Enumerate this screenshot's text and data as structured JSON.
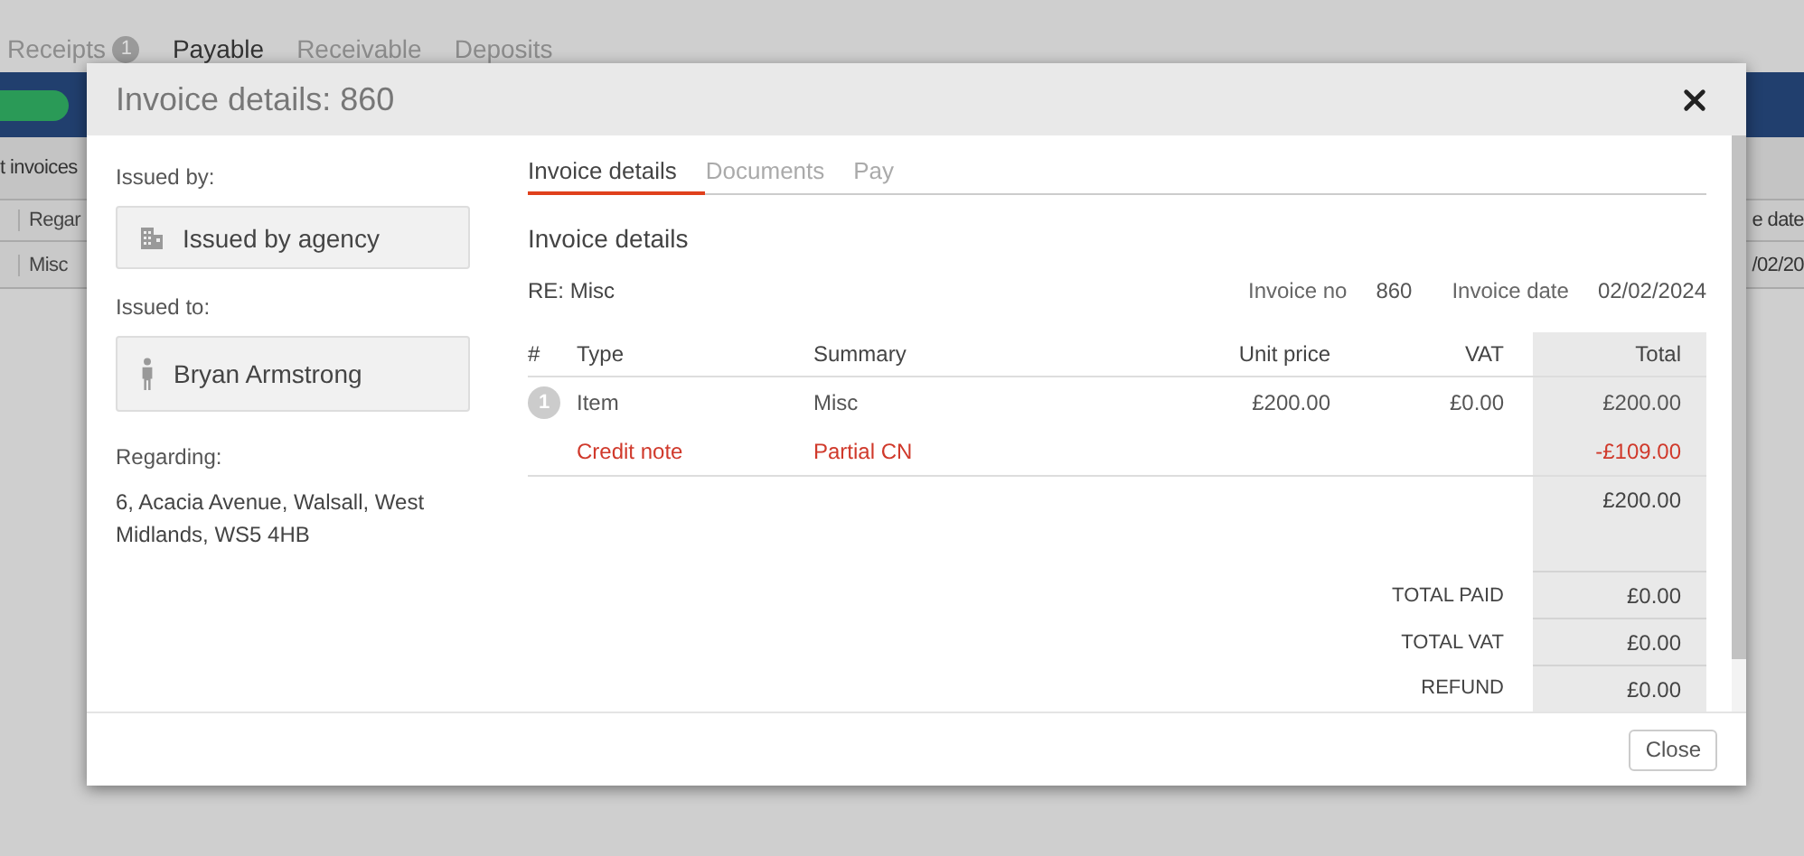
{
  "page": {
    "tabs": [
      {
        "label": "Receipts",
        "badge": "1",
        "selected": false
      },
      {
        "label": "Payable",
        "selected": true
      },
      {
        "label": "Receivable",
        "selected": false
      },
      {
        "label": "Deposits",
        "selected": false
      }
    ],
    "list_caption": "t invoices",
    "table": {
      "columns": [
        "Regar",
        "e date"
      ],
      "rows": [
        [
          "Misc",
          "/02/20"
        ]
      ]
    }
  },
  "dialog": {
    "title": "Invoice details: 860",
    "issued_by": {
      "label": "Issued by:",
      "value": "Issued by agency"
    },
    "issued_to": {
      "label": "Issued to:",
      "value": "Bryan Armstrong"
    },
    "regarding": {
      "label": "Regarding:",
      "value": "6, Acacia Avenue, Walsall, West Midlands, WS5 4HB"
    },
    "tabs": [
      {
        "label": "Invoice details",
        "selected": true
      },
      {
        "label": "Documents",
        "selected": false
      },
      {
        "label": "Pay",
        "selected": false
      }
    ],
    "heading": "Invoice details",
    "re": "RE: Misc",
    "meta": [
      {
        "label": "Invoice no",
        "value": "860"
      },
      {
        "label": "Invoice date",
        "value": "02/02/2024"
      }
    ],
    "columns": [
      "#",
      "Type",
      "Summary",
      "Unit price",
      "VAT",
      "Total"
    ],
    "lines": [
      {
        "kind": "item",
        "number": "1",
        "type": "Item",
        "summary": "Misc",
        "unit_price": "£200.00",
        "vat": "£0.00",
        "total": "£200.00"
      },
      {
        "kind": "credit_note",
        "type": "Credit note",
        "summary": "Partial CN",
        "total": "-£109.00"
      }
    ],
    "subtotal": "£200.00",
    "totals": [
      {
        "label": "TOTAL PAID",
        "value": "£0.00"
      },
      {
        "label": "TOTAL VAT",
        "value": "£0.00"
      },
      {
        "label": "REFUND",
        "value": "£0.00"
      }
    ],
    "close_button": "Close"
  }
}
